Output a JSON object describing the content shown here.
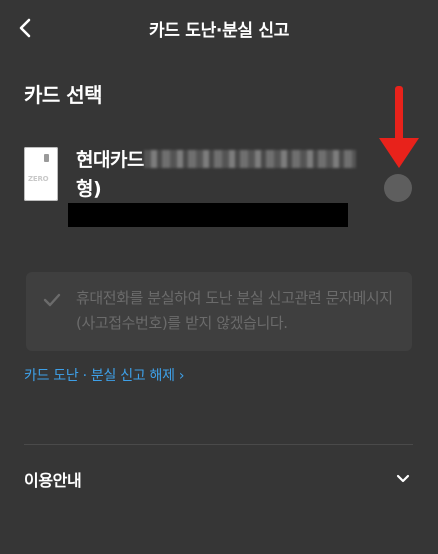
{
  "header": {
    "title": "카드 도난·분실 신고"
  },
  "section": {
    "title": "카드 선택"
  },
  "card": {
    "name_prefix": "현대카드",
    "name_suffix": "형)",
    "logo_text": "ZERO",
    "selected": false
  },
  "notice": {
    "text": "휴대전화를 분실하여 도난 분실 신고관련 문자메시지(사고접수번호)를 받지 않겠습니다.",
    "checked": false
  },
  "cancel_link": {
    "label": "카드 도난 · 분실 신고 해제",
    "arrow": "›"
  },
  "guide": {
    "label": "이용안내"
  },
  "colors": {
    "background": "#363636",
    "link": "#3ea0e8",
    "annotation_arrow": "#e8221b",
    "radio": "#5e5e5e"
  },
  "icons": {
    "back": "back-arrow-icon",
    "check": "check-icon",
    "chevron": "chevron-down-icon"
  }
}
